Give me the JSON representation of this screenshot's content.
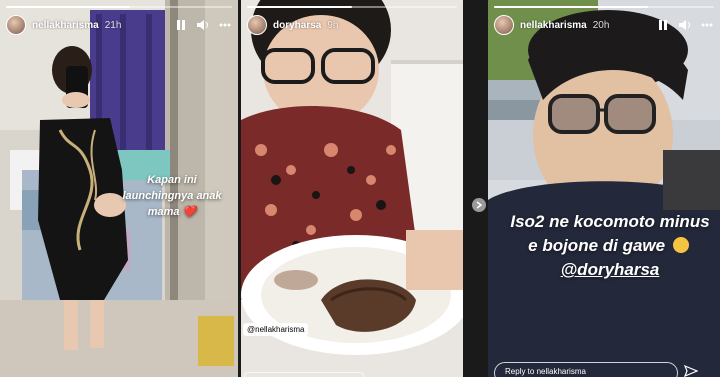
{
  "stories": [
    {
      "username": "nellakharisma",
      "time": "21h",
      "caption": "Kapan ini launchingnya anak mama ❤️",
      "progress": 0.55
    },
    {
      "username": "doryharsa",
      "time": "9h",
      "mention_tag": "@nellakharisma",
      "progress": 0.5
    },
    {
      "username": "nellakharisma",
      "time": "20h",
      "caption_text": "Iso2 ne kocomoto minus e bojone di gawe",
      "caption_mention": "@doryharsa",
      "reply_placeholder": "Reply to nellakharisma",
      "progress": 0.7
    }
  ],
  "icons": {
    "pause": "pause-icon",
    "sound": "speaker-icon",
    "more": "more-icon",
    "next": "chevron-right-icon",
    "share": "send-icon"
  },
  "colors": {
    "background": "#1a1a1a",
    "emoji": "#f5c542",
    "heart": "#e0245e"
  }
}
